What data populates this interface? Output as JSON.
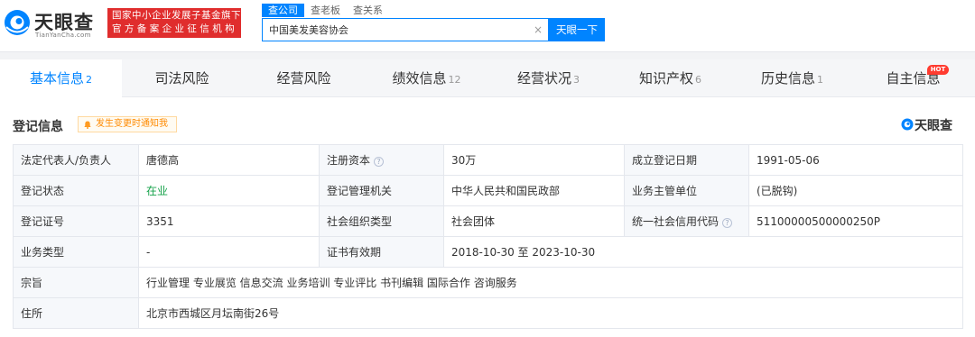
{
  "header": {
    "logo_title": "天眼查",
    "logo_sub": "TianYanCha.com",
    "badge_line1": "国家中小企业发展子基金旗下",
    "badge_line2": "官方备案企业征信机构",
    "search_tabs": [
      "查公司",
      "查老板",
      "查关系"
    ],
    "search_value": "中国美发美容协会",
    "clear_symbol": "×",
    "search_button": "天眼一下"
  },
  "tabs": [
    {
      "label": "基本信息",
      "count": "2"
    },
    {
      "label": "司法风险",
      "count": ""
    },
    {
      "label": "经营风险",
      "count": ""
    },
    {
      "label": "绩效信息",
      "count": "12"
    },
    {
      "label": "经营状况",
      "count": "3"
    },
    {
      "label": "知识产权",
      "count": "6"
    },
    {
      "label": "历史信息",
      "count": "1"
    },
    {
      "label": "自主信息",
      "count": ""
    }
  ],
  "hot_badge": "HOT",
  "section": {
    "title": "登记信息",
    "notify": "发生变更时通知我",
    "brand": "天眼查"
  },
  "registration": {
    "legal_rep_label": "法定代表人/负责人",
    "legal_rep_value": "唐德高",
    "reg_capital_label": "注册资本",
    "reg_capital_value": "30万",
    "est_date_label": "成立登记日期",
    "est_date_value": "1991-05-06",
    "status_label": "登记状态",
    "status_value": "在业",
    "authority_label": "登记管理机关",
    "authority_value": "中华人民共和国民政部",
    "supervisor_label": "业务主管单位",
    "supervisor_value": "(已脱钩)",
    "cert_no_label": "登记证号",
    "cert_no_value": "3351",
    "org_type_label": "社会组织类型",
    "org_type_value": "社会团体",
    "credit_code_label": "统一社会信用代码",
    "credit_code_value": "51100000500000250P",
    "biz_type_label": "业务类型",
    "biz_type_value": "-",
    "validity_label": "证书有效期",
    "validity_value": "2018-10-30 至 2023-10-30",
    "purpose_label": "宗旨",
    "purpose_value": "行业管理 专业展览 信息交流 业务培训 专业评比 书刊编辑 国际合作 咨询服务",
    "address_label": "住所",
    "address_value": "北京市西城区月坛南街26号"
  },
  "colors": {
    "accent": "#0084ff",
    "badge_red": "#e02d2d",
    "status_green": "#15a24a",
    "notify_orange": "#ff8a00"
  },
  "icons": [
    "tianyancha-logo-icon",
    "clear-icon",
    "bell-icon",
    "question-icon"
  ]
}
